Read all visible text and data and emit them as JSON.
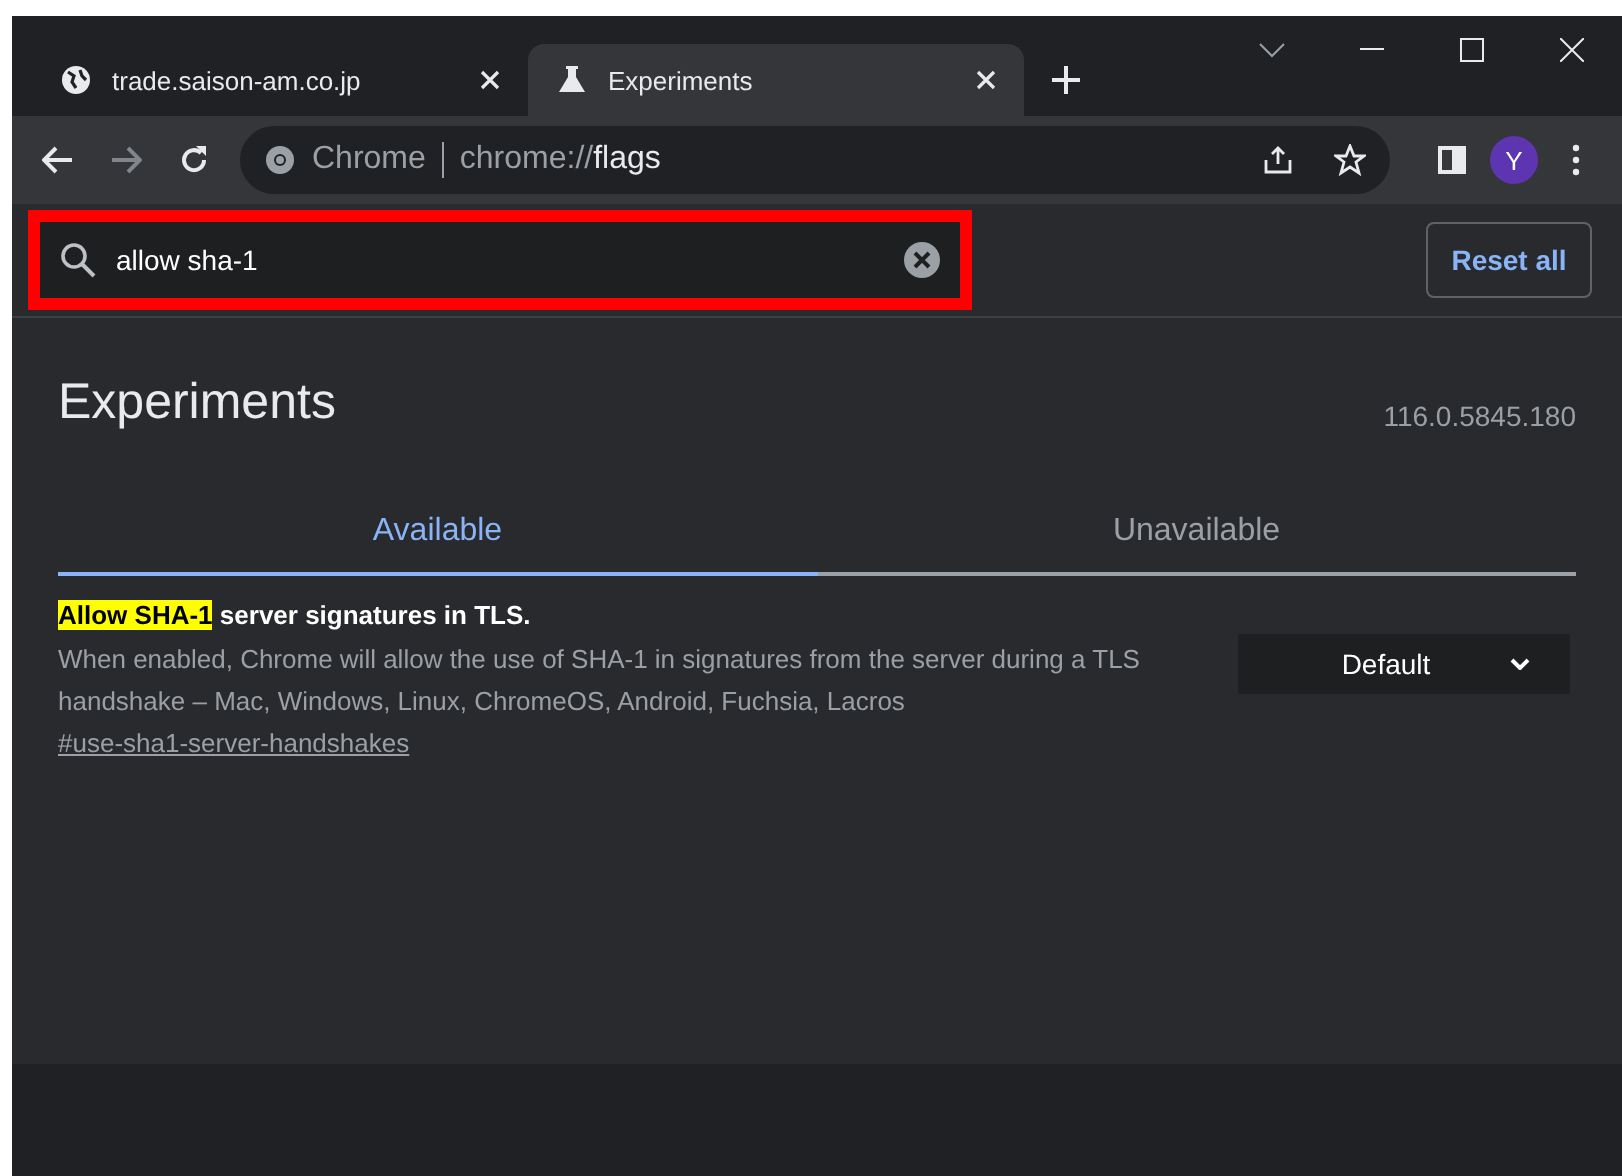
{
  "browser_tabs": [
    {
      "title": "trade.saison-am.co.jp",
      "selected": false
    },
    {
      "title": "Experiments",
      "selected": true
    }
  ],
  "omnibox": {
    "site": "Chrome",
    "url_prefix": "chrome://",
    "url_path": "flags"
  },
  "profile": {
    "initial": "Y"
  },
  "search": {
    "value": "allow sha-1",
    "highlighted": true
  },
  "reset_button": "Reset all",
  "heading": "Experiments",
  "version": "116.0.5845.180",
  "tabs": [
    {
      "label": "Available",
      "selected": true
    },
    {
      "label": "Unavailable",
      "selected": false
    }
  ],
  "flags": [
    {
      "title_match": "Allow SHA-1",
      "title_rest": "server signatures in TLS.",
      "description": "When enabled, Chrome will allow the use of SHA-1 in signatures from the server during a TLS handshake – Mac, Windows, Linux, ChromeOS, Android, Fuchsia, Lacros",
      "link": "#use-sha1-server-handshakes",
      "value": "Default"
    }
  ]
}
